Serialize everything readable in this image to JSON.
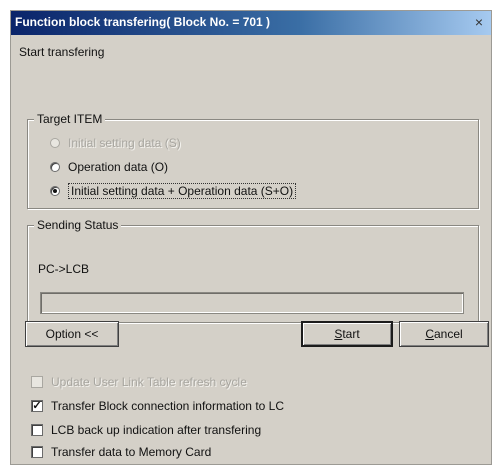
{
  "window": {
    "title": "Function block transfering( Block No. = 701 )",
    "close_glyph": "×",
    "status_message": "Start transfering"
  },
  "target_item": {
    "group_title": "Target ITEM",
    "options": [
      {
        "label": "Initial setting data (S)",
        "selected": false,
        "enabled": false
      },
      {
        "label": "Operation data (O)",
        "selected": false,
        "enabled": true
      },
      {
        "label": "Initial setting data + Operation data (S+O)",
        "selected": true,
        "enabled": true
      }
    ]
  },
  "sending_status": {
    "group_title": "Sending Status",
    "route": "PC->LCB",
    "progress": 0
  },
  "buttons": {
    "option": "Option <<",
    "start_underlined": "S",
    "start_rest": "tart",
    "cancel_underlined": "C",
    "cancel_rest": "ancel"
  },
  "options_checks": [
    {
      "label": "Update User Link Table refresh cycle",
      "checked": false,
      "enabled": false
    },
    {
      "label": "Transfer Block connection information to LC",
      "checked": true,
      "enabled": true
    },
    {
      "label": "LCB back up indication after transfering",
      "checked": false,
      "enabled": true
    },
    {
      "label": "Transfer data to Memory Card",
      "checked": false,
      "enabled": true
    }
  ],
  "colors": {
    "dialog_face": "#d4d0c8",
    "title_bar_start": "#0a246a",
    "title_bar_end": "#a6caf0"
  }
}
